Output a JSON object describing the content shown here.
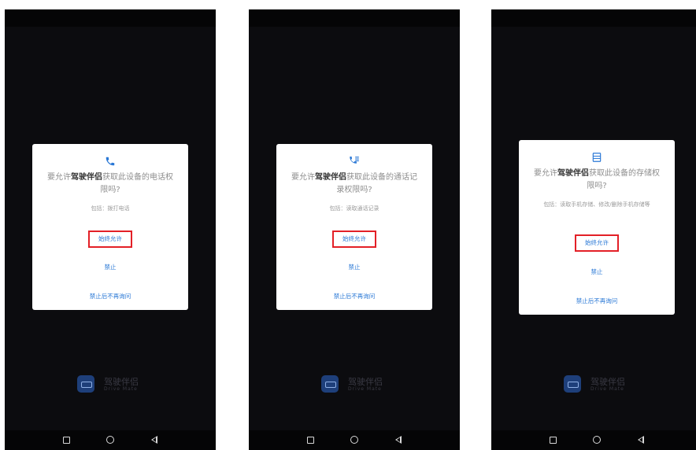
{
  "app": {
    "name_cn": "驾驶伴侣",
    "name_en": "Drive Mate"
  },
  "colors": {
    "accent": "#2a78d6",
    "highlight": "#e32027"
  },
  "screens": [
    {
      "icon": "phone-icon",
      "title_pre": "要允许",
      "title_app": "驾驶伴侣",
      "title_post": "获取此设备的电话权限吗?",
      "includes": "包括：拨打电话",
      "allow_label": "始终允许",
      "deny_label": "禁止",
      "deny_never_label": "禁止后不再询问"
    },
    {
      "icon": "call-log-icon",
      "title_pre": "要允许",
      "title_app": "驾驶伴侣",
      "title_post": "获取此设备的通话记录权限吗?",
      "includes": "包括：读取通话记录",
      "allow_label": "始终允许",
      "deny_label": "禁止",
      "deny_never_label": "禁止后不再询问"
    },
    {
      "icon": "storage-icon",
      "title_pre": "要允许",
      "title_app": "驾驶伴侣",
      "title_post": "获取此设备的存储权限吗?",
      "includes": "包括：读取手机存储、修改/删除手机存储等",
      "allow_label": "始终允许",
      "deny_label": "禁止",
      "deny_never_label": "禁止后不再询问"
    }
  ]
}
